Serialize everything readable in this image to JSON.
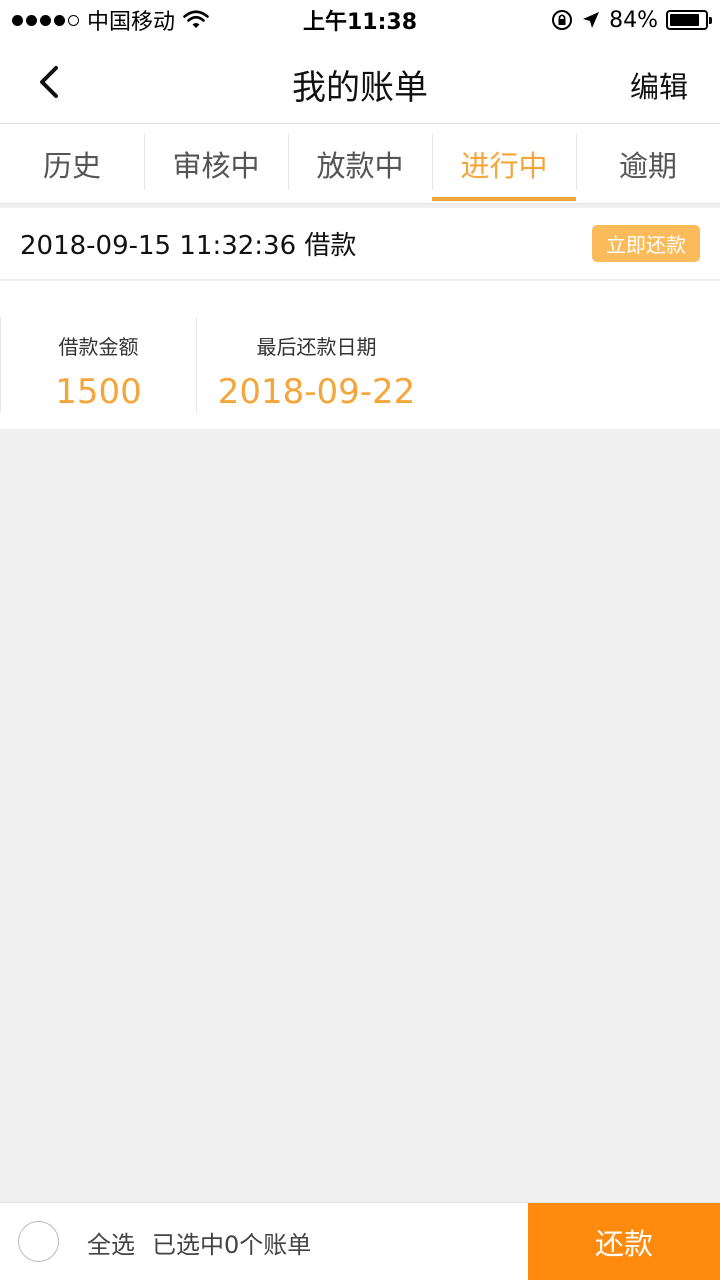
{
  "status_bar": {
    "carrier": "中国移动",
    "time": "上午11:38",
    "battery_text": "84%",
    "battery_level": 0.84,
    "icons": [
      "signal-dots",
      "wifi-icon",
      "orientation-lock-icon",
      "location-arrow-icon",
      "battery-icon"
    ]
  },
  "nav": {
    "title": "我的账单",
    "edit_label": "编辑",
    "back_icon": "chevron-left-icon"
  },
  "tabs": [
    {
      "label": "历史",
      "active": false
    },
    {
      "label": "审核中",
      "active": false
    },
    {
      "label": "放款中",
      "active": false
    },
    {
      "label": "进行中",
      "active": true
    },
    {
      "label": "逾期",
      "active": false
    }
  ],
  "bill": {
    "title": "2018-09-15 11:32:36 借款",
    "pay_now_label": "立即还款",
    "amount_label": "借款金额",
    "amount_value": "1500",
    "due_label": "最后还款日期",
    "due_value": "2018-09-22"
  },
  "bottom_bar": {
    "select_all_label": "全选",
    "selected_count_text": "已选中0个账单",
    "repay_label": "还款"
  },
  "colors": {
    "accent": "#f5a63a",
    "repay_button": "#ff8a0d",
    "pay_now_badge": "#fbbb5b",
    "background": "#f0f0f0"
  }
}
